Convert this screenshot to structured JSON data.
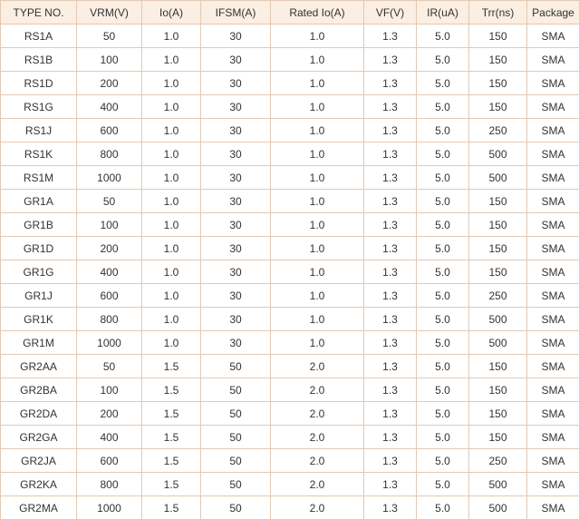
{
  "table": {
    "headers": [
      "TYPE NO.",
      "VRM(V)",
      "Io(A)",
      "IFSM(A)",
      "Rated Io(A)",
      "VF(V)",
      "IR(uA)",
      "Trr(ns)",
      "Package"
    ],
    "rows": [
      [
        "RS1A",
        "50",
        "1.0",
        "30",
        "1.0",
        "1.3",
        "5.0",
        "150",
        "SMA"
      ],
      [
        "RS1B",
        "100",
        "1.0",
        "30",
        "1.0",
        "1.3",
        "5.0",
        "150",
        "SMA"
      ],
      [
        "RS1D",
        "200",
        "1.0",
        "30",
        "1.0",
        "1.3",
        "5.0",
        "150",
        "SMA"
      ],
      [
        "RS1G",
        "400",
        "1.0",
        "30",
        "1.0",
        "1.3",
        "5.0",
        "150",
        "SMA"
      ],
      [
        "RS1J",
        "600",
        "1.0",
        "30",
        "1.0",
        "1.3",
        "5.0",
        "250",
        "SMA"
      ],
      [
        "RS1K",
        "800",
        "1.0",
        "30",
        "1.0",
        "1.3",
        "5.0",
        "500",
        "SMA"
      ],
      [
        "RS1M",
        "1000",
        "1.0",
        "30",
        "1.0",
        "1.3",
        "5.0",
        "500",
        "SMA"
      ],
      [
        "GR1A",
        "50",
        "1.0",
        "30",
        "1.0",
        "1.3",
        "5.0",
        "150",
        "SMA"
      ],
      [
        "GR1B",
        "100",
        "1.0",
        "30",
        "1.0",
        "1.3",
        "5.0",
        "150",
        "SMA"
      ],
      [
        "GR1D",
        "200",
        "1.0",
        "30",
        "1.0",
        "1.3",
        "5.0",
        "150",
        "SMA"
      ],
      [
        "GR1G",
        "400",
        "1.0",
        "30",
        "1.0",
        "1.3",
        "5.0",
        "150",
        "SMA"
      ],
      [
        "GR1J",
        "600",
        "1.0",
        "30",
        "1.0",
        "1.3",
        "5.0",
        "250",
        "SMA"
      ],
      [
        "GR1K",
        "800",
        "1.0",
        "30",
        "1.0",
        "1.3",
        "5.0",
        "500",
        "SMA"
      ],
      [
        "GR1M",
        "1000",
        "1.0",
        "30",
        "1.0",
        "1.3",
        "5.0",
        "500",
        "SMA"
      ],
      [
        "GR2AA",
        "50",
        "1.5",
        "50",
        "2.0",
        "1.3",
        "5.0",
        "150",
        "SMA"
      ],
      [
        "GR2BA",
        "100",
        "1.5",
        "50",
        "2.0",
        "1.3",
        "5.0",
        "150",
        "SMA"
      ],
      [
        "GR2DA",
        "200",
        "1.5",
        "50",
        "2.0",
        "1.3",
        "5.0",
        "150",
        "SMA"
      ],
      [
        "GR2GA",
        "400",
        "1.5",
        "50",
        "2.0",
        "1.3",
        "5.0",
        "150",
        "SMA"
      ],
      [
        "GR2JA",
        "600",
        "1.5",
        "50",
        "2.0",
        "1.3",
        "5.0",
        "250",
        "SMA"
      ],
      [
        "GR2KA",
        "800",
        "1.5",
        "50",
        "2.0",
        "1.3",
        "5.0",
        "500",
        "SMA"
      ],
      [
        "GR2MA",
        "1000",
        "1.5",
        "50",
        "2.0",
        "1.3",
        "5.0",
        "500",
        "SMA"
      ]
    ]
  }
}
